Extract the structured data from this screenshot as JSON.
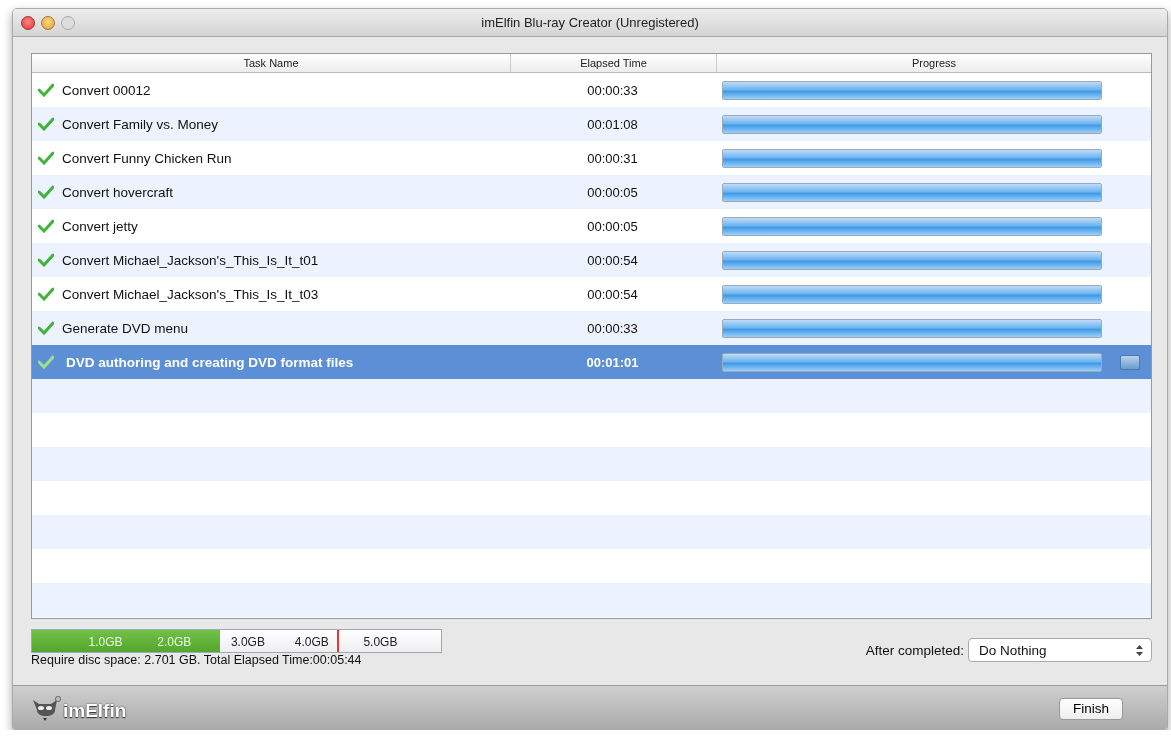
{
  "window": {
    "title": "imElfin Blu-ray Creator (Unregistered)"
  },
  "table": {
    "columns": [
      "Task Name",
      "Elapsed Time",
      "Progress"
    ],
    "rows": [
      {
        "task": "Convert 00012",
        "elapsed": "00:00:33",
        "done": true,
        "level": 1,
        "selected": false
      },
      {
        "task": "Convert Family vs. Money",
        "elapsed": "00:01:08",
        "done": true,
        "level": 1,
        "selected": false
      },
      {
        "task": "Convert Funny Chicken Run",
        "elapsed": "00:00:31",
        "done": true,
        "level": 1,
        "selected": false
      },
      {
        "task": "Convert hovercraft",
        "elapsed": "00:00:05",
        "done": true,
        "level": 1,
        "selected": false
      },
      {
        "task": "Convert jetty",
        "elapsed": "00:00:05",
        "done": true,
        "level": 1,
        "selected": false
      },
      {
        "task": "Convert Michael_Jackson's_This_Is_It_t01",
        "elapsed": "00:00:54",
        "done": true,
        "level": 1,
        "selected": false
      },
      {
        "task": "Convert Michael_Jackson's_This_Is_It_t03",
        "elapsed": "00:00:54",
        "done": true,
        "level": 1,
        "selected": false
      },
      {
        "task": "Generate DVD menu",
        "elapsed": "00:00:33",
        "done": true,
        "level": 1,
        "selected": false
      },
      {
        "task": "DVD authoring and creating DVD format files",
        "elapsed": "00:01:01",
        "done": true,
        "level": 1,
        "selected": true
      }
    ]
  },
  "disc_gauge": {
    "level": 0.46,
    "limit": {
      "level": 0.745
    },
    "labels": [
      "1.0GB",
      "2.0GB",
      "3.0GB",
      "4.0GB",
      "5.0GB"
    ]
  },
  "summary": "Require disc space: 2.701 GB. Total Elapsed Time:00:05:44",
  "after_completed": {
    "label": "After completed:",
    "value": "Do Nothing"
  },
  "footer": {
    "logo": "imElfin",
    "buttons": [
      "Finish"
    ]
  }
}
